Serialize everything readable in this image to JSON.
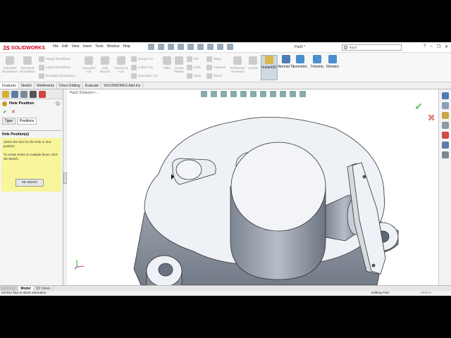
{
  "app": {
    "brand": "SOLIDWORKS",
    "doc_title": "Part2 *"
  },
  "menu": [
    "File",
    "Edit",
    "View",
    "Insert",
    "Tools",
    "Window",
    "Help"
  ],
  "search": {
    "placeholder": "keys"
  },
  "ribbon": {
    "group1": [
      "Extruded Boss/Base",
      "Revolved Boss/Base"
    ],
    "group2": [
      "Swept Boss/Base",
      "Lofted Boss/Base",
      "Boundary Boss/Base"
    ],
    "group3": [
      "Extruded Cut",
      "Hole Wizard",
      "Revolved Cut"
    ],
    "group4": [
      "Swept Cut",
      "Lofted Cut",
      "Boundary Cut"
    ],
    "group5": [
      "Fillet",
      "Linear Pattern"
    ],
    "group6": [
      "Rib",
      "Draft",
      "Shell"
    ],
    "group7": [
      "Wrap",
      "Intersect",
      "Mirror"
    ],
    "group8": [
      "Reference Geometry",
      "Curves"
    ],
    "views": [
      "Instant3D",
      "Normal To",
      "Isometric",
      "Trimetric",
      "Dimetric"
    ]
  },
  "tabs": [
    "Features",
    "Sketch",
    "Weldments",
    "Direct Editing",
    "Evaluate",
    "SOLIDWORKS Add-Ins"
  ],
  "panel": {
    "title": "Hole Position",
    "ok": "✔",
    "cancel": "✕",
    "subtabs": [
      "Type",
      "Positions"
    ],
    "section": "Hole Position(s)",
    "msg1": "Select the face for the hole or slot position.",
    "msg2": "To create holes on multiple faces, click 3D Sketch.",
    "sketch_btn": "3D Sketch"
  },
  "viewport": {
    "tree_label": "Part2  (Default<<..."
  },
  "bottom_tabs": [
    "MotionM",
    "Model",
    "3D Views"
  ],
  "status": {
    "left": "Hit Esc key to abort animation",
    "mode": "Editing Part",
    "units": "MMGS"
  },
  "colors": {
    "accent": "#4a8fcf",
    "panel_msg": "#f8f59a",
    "brand": "#d0021b"
  }
}
